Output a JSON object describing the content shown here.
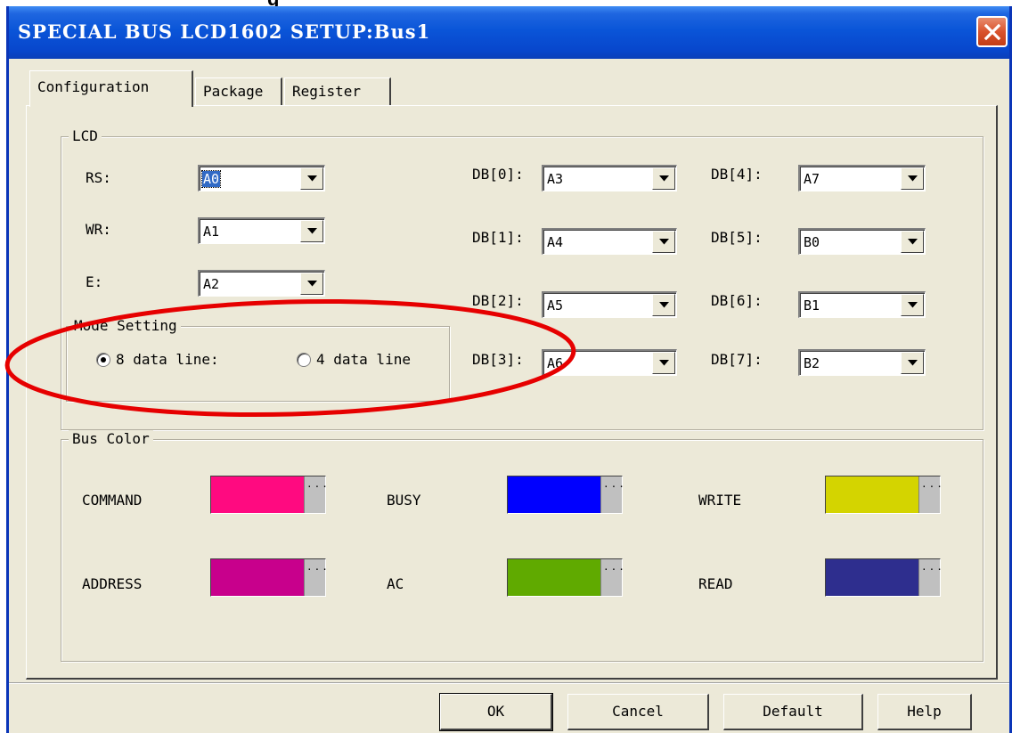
{
  "caption_fragment": "g",
  "window": {
    "title": "SPECIAL BUS LCD1602 SETUP:Bus1"
  },
  "tabs": [
    {
      "label": "Configuration",
      "active": true
    },
    {
      "label": "Package",
      "active": false
    },
    {
      "label": "Register",
      "active": false
    }
  ],
  "lcd": {
    "legend": "LCD",
    "control_pins": [
      {
        "label": "RS:",
        "value": "A0",
        "selected": true
      },
      {
        "label": "WR:",
        "value": "A1",
        "selected": false
      },
      {
        "label": "E:",
        "value": "A2",
        "selected": false
      }
    ],
    "data_pins_left": [
      {
        "label": "DB[0]:",
        "value": "A3"
      },
      {
        "label": "DB[1]:",
        "value": "A4"
      },
      {
        "label": "DB[2]:",
        "value": "A5"
      },
      {
        "label": "DB[3]:",
        "value": "A6"
      }
    ],
    "data_pins_right": [
      {
        "label": "DB[4]:",
        "value": "A7"
      },
      {
        "label": "DB[5]:",
        "value": "B0"
      },
      {
        "label": "DB[6]:",
        "value": "B1"
      },
      {
        "label": "DB[7]:",
        "value": "B2"
      }
    ],
    "mode_setting": {
      "legend": "Mode Setting",
      "options": [
        {
          "label": "8 data line:",
          "checked": true
        },
        {
          "label": "4 data line",
          "checked": false
        }
      ]
    }
  },
  "bus_color": {
    "legend": "Bus Color",
    "items": [
      {
        "label": "COMMAND",
        "color": "#ff0a80"
      },
      {
        "label": "BUSY",
        "color": "#0000ff"
      },
      {
        "label": "WRITE",
        "color": "#d4d400"
      },
      {
        "label": "ADDRESS",
        "color": "#c8008c"
      },
      {
        "label": "AC",
        "color": "#60aa00"
      },
      {
        "label": "READ",
        "color": "#2e2e8e"
      }
    ],
    "more_label": "..."
  },
  "buttons": {
    "ok": "OK",
    "cancel": "Cancel",
    "default": "Default",
    "help": "Help"
  },
  "annotation": {
    "shape": "ellipse",
    "color": "#e60000",
    "target": "mode-setting"
  }
}
